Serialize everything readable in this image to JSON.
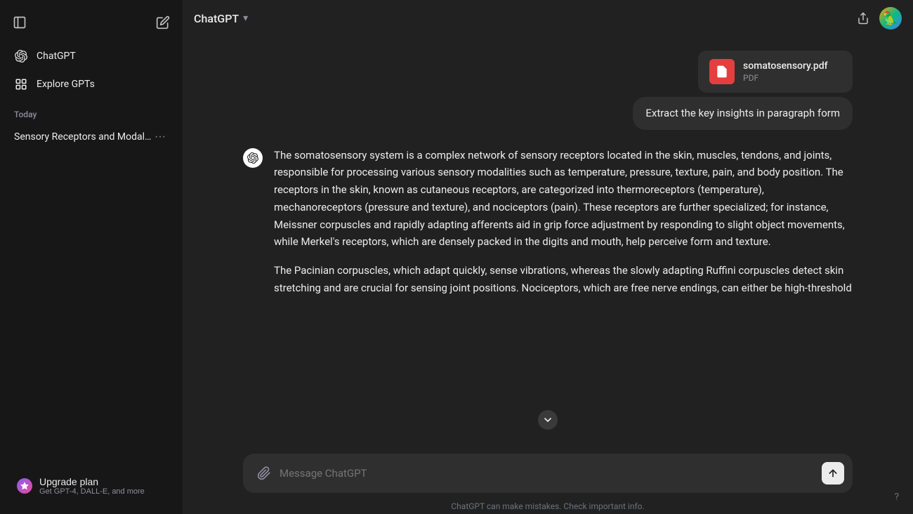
{
  "sidebar": {
    "chatgpt_label": "ChatGPT",
    "explore_label": "Explore GPTs",
    "today_label": "Today",
    "chat_item": "Sensory Receptors and Modalit...",
    "upgrade_label": "Upgrade plan",
    "upgrade_sublabel": "Get GPT-4, DALL-E, and more"
  },
  "header": {
    "title": "ChatGPT",
    "chevron": "▾"
  },
  "messages": {
    "pdf_name": "somatosensory.pdf",
    "pdf_type": "PDF",
    "user_message": "Extract the key insights in paragraph form",
    "assistant_paragraph1": "The somatosensory system is a complex network of sensory receptors located in the skin, muscles, tendons, and joints, responsible for processing various sensory modalities such as temperature, pressure, texture, pain, and body position. The receptors in the skin, known as cutaneous receptors, are categorized into thermoreceptors (temperature), mechanoreceptors (pressure and texture), and nociceptors (pain). These receptors are further specialized; for instance, Meissner corpuscles and rapidly adapting afferents aid in grip force adjustment by responding to slight object movements, while Merkel's receptors, which are densely packed in the digits and mouth, help perceive form and texture.",
    "assistant_paragraph2": "The Pacinian corpuscles, which adapt quickly, sense vibrations, whereas the slowly adapting Ruffini corpuscles detect skin stretching and are crucial for sensing joint positions. Nociceptors, which are free nerve endings, can either be high-threshold"
  },
  "input": {
    "placeholder": "Message ChatGPT"
  },
  "footer": {
    "note": "ChatGPT can make mistakes. Check important info."
  }
}
